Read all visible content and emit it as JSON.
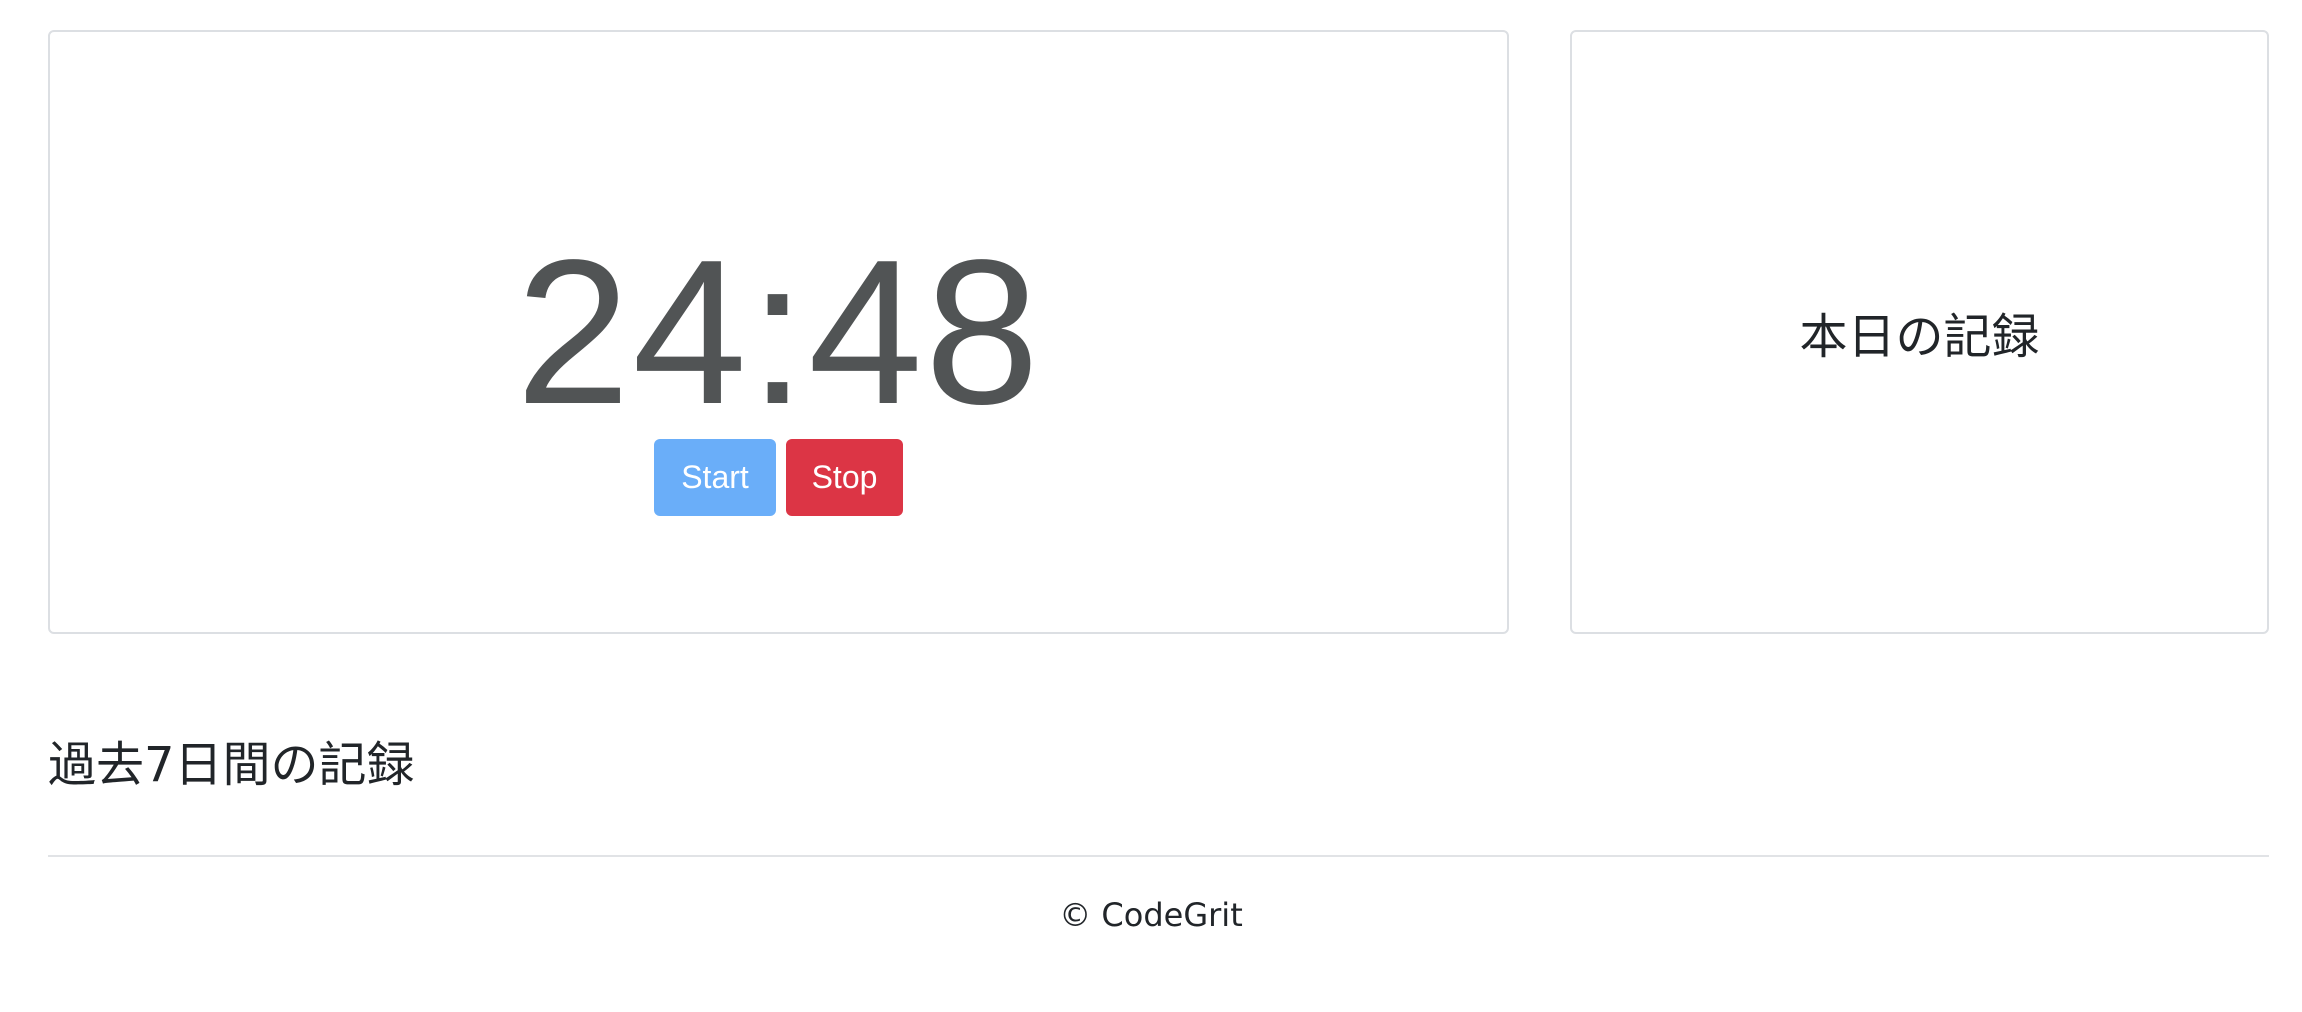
{
  "timer": {
    "display": "24:48",
    "start_label": "Start",
    "stop_label": "Stop"
  },
  "today": {
    "title": "本日の記録"
  },
  "week": {
    "title": "過去7日間の記録"
  },
  "footer": {
    "copyright": "© CodeGrit"
  },
  "colors": {
    "start_button": "#6aaef9",
    "stop_button": "#dc3545",
    "timer_text": "#515455",
    "border": "#dcdfe3"
  }
}
